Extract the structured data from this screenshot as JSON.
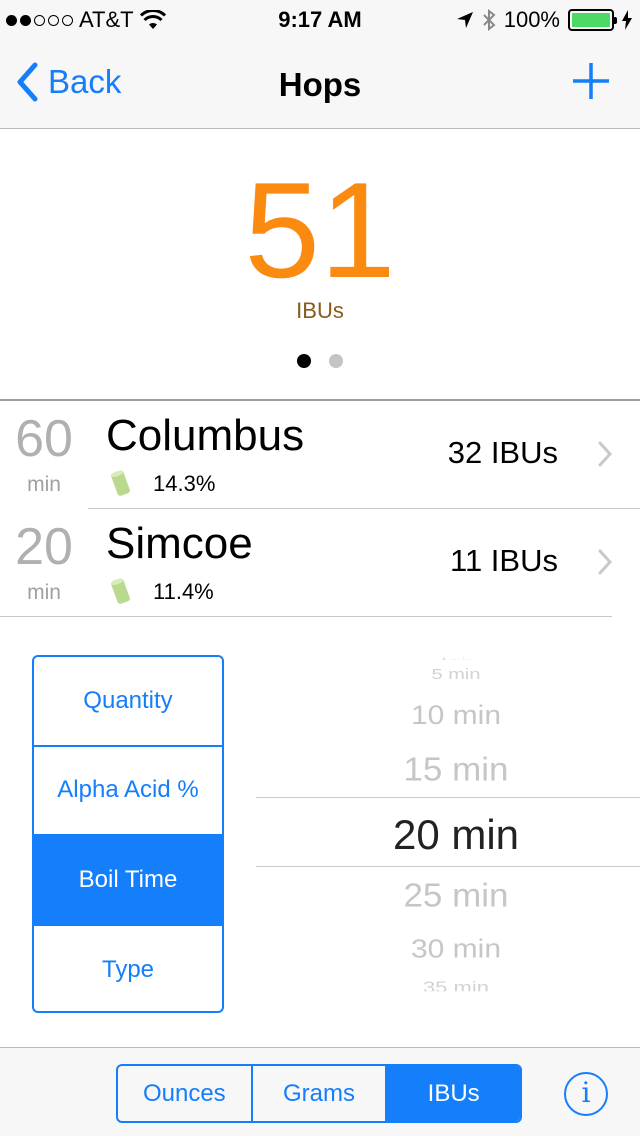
{
  "status_bar": {
    "carrier": "AT&T",
    "time": "9:17 AM",
    "battery": "100%",
    "battery_color": "#4cd964"
  },
  "nav": {
    "back_label": "Back",
    "title": "Hops",
    "add_icon": "plus-icon"
  },
  "summary": {
    "ibus_value": "51",
    "ibus_label": "IBUs",
    "accent_color": "#fb8a10",
    "page_count": 2,
    "current_page": 1
  },
  "hops": [
    {
      "time": "60",
      "unit": "min",
      "name": "Columbus",
      "alpha": "14.3%",
      "ibus": "32 IBUs"
    },
    {
      "time": "20",
      "unit": "min",
      "name": "Simcoe",
      "alpha": "11.4%",
      "ibus": "11 IBUs"
    }
  ],
  "field_selector": {
    "options": [
      "Quantity",
      "Alpha Acid %",
      "Boil Time",
      "Type"
    ],
    "selected": "Boil Time"
  },
  "picker": {
    "items": [
      "5 min",
      "10 min",
      "15 min",
      "20 min",
      "25 min",
      "30 min",
      "35 min"
    ],
    "selected": "20 min"
  },
  "units_toggle": {
    "options": [
      "Ounces",
      "Grams",
      "IBUs"
    ],
    "selected": "IBUs"
  },
  "info_label": "i",
  "tint_color": "#147efb"
}
